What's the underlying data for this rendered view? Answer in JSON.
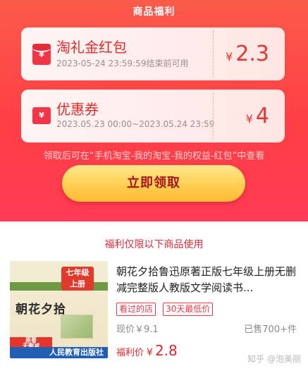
{
  "header": {
    "title": "商品福利"
  },
  "coupons": [
    {
      "icon": "red-envelope-icon",
      "icon_glyph": "¥",
      "title": "淘礼金红包",
      "subtitle": "2023-05-24 23:59:59结束前可用",
      "currency": "¥",
      "amount": "2.3"
    },
    {
      "icon": "coupon-ticket-icon",
      "icon_glyph": "¥",
      "title": "优惠券",
      "subtitle": "2023.05.23 00:00~2023.05.24 23:59",
      "currency": "¥",
      "amount": "4"
    }
  ],
  "hint": "领取后可在“手机淘宝-我的淘宝-我的权益-红包”中查看",
  "claim_button": "立即领取",
  "scope_text": "福利仅限以下商品使用",
  "product": {
    "thumbnail": {
      "badge": "七年级\n上册",
      "title_text": "朝花夕拾",
      "band_left": "原著\n无删减",
      "band_bottom": "人民教育出版社"
    },
    "title": "朝花夕拾鲁迅原著正版七年级上册无删减完整版人教版文学阅读书...",
    "tags": [
      "看过的店",
      "30天最低价"
    ],
    "current_price": "现价￥9.1",
    "sold": "已售700+件",
    "benefit_label": "福利价",
    "benefit_currency": "¥",
    "benefit_price": "2.8"
  },
  "watermark": "知乎 @泡美丽",
  "colors": {
    "accent": "#ff3f45",
    "price_red": "#e8352f",
    "button_gold": "#ffcc4d",
    "button_text": "#a8141c"
  }
}
